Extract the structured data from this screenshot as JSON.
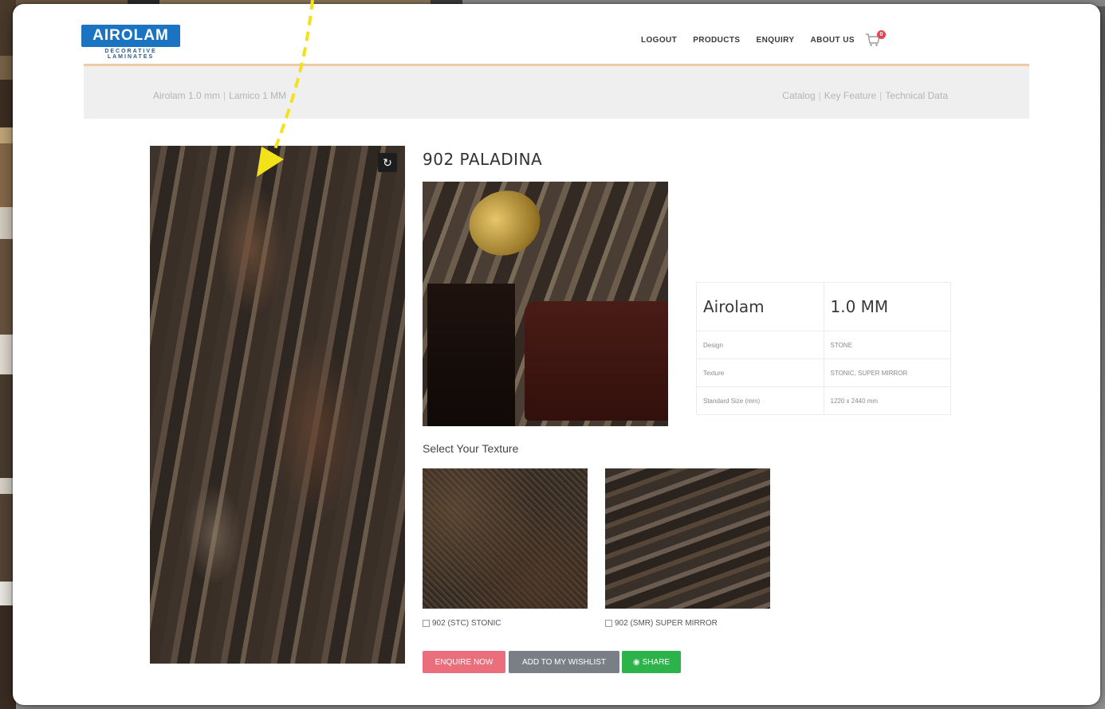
{
  "header": {
    "logo_text": "AIROLAM",
    "logo_subtitle": "DECORATIVE LAMINATES",
    "nav": [
      "LOGOUT",
      "PRODUCTS",
      "ENQUIRY",
      "ABOUT US"
    ],
    "cart_count": "0"
  },
  "subbar": {
    "left_items": [
      "Airolam 1.0 mm",
      "Lamico 1 MM"
    ],
    "right_items": [
      "Catalog",
      "Key Feature",
      "Technical Data"
    ]
  },
  "product": {
    "title": "902 PALADINA",
    "spec": {
      "brand": "Airolam",
      "thickness": "1.0 MM",
      "rows": [
        {
          "label": "Design",
          "value": "STONE"
        },
        {
          "label": "Texture",
          "value": "STONIC, SUPER MIRROR"
        },
        {
          "label": "Standard Size (mm)",
          "value": "1220 x 2440 mm"
        }
      ]
    },
    "select_texture_label": "Select Your Texture",
    "textures": [
      {
        "label": "902 (STC) STONIC"
      },
      {
        "label": "902 (SMR) SUPER MIRROR"
      }
    ],
    "buttons": {
      "enquire": "ENQUIRE NOW",
      "wishlist": "ADD TO MY WISHLIST",
      "share": "SHARE"
    }
  },
  "annotation_color": "#f2e21a",
  "colors": {
    "brand_blue": "#1a74c2",
    "enquire_red": "#ea6e7c",
    "wishlist_gray": "#7a7f86",
    "share_green": "#2cb34a"
  }
}
